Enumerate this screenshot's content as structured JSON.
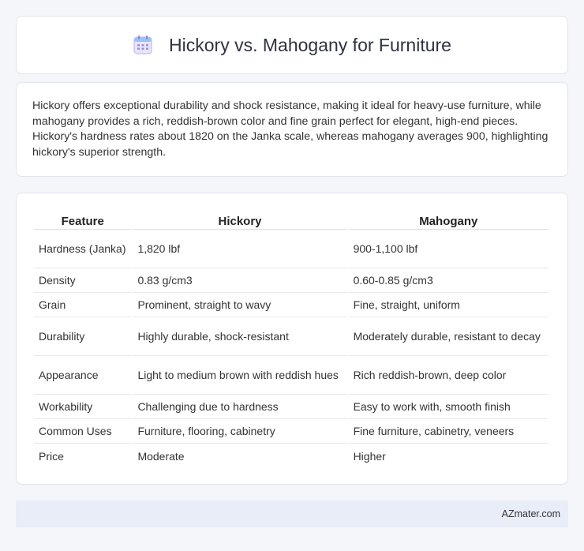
{
  "header": {
    "title": "Hickory vs. Mahogany for Furniture",
    "icon": "calendar-icon"
  },
  "summary": {
    "text": "Hickory offers exceptional durability and shock resistance, making it ideal for heavy-use furniture, while mahogany provides a rich, reddish-brown color and fine grain perfect for elegant, high-end pieces. Hickory's hardness rates about 1820 on the Janka scale, whereas mahogany averages 900, highlighting hickory's superior strength."
  },
  "table": {
    "headers": [
      "Feature",
      "Hickory",
      "Mahogany"
    ],
    "rows": [
      [
        "Hardness (Janka)",
        "1,820 lbf",
        "900-1,100 lbf"
      ],
      [
        "Density",
        "0.83 g/cm3",
        "0.60-0.85 g/cm3"
      ],
      [
        "Grain",
        "Prominent, straight to wavy",
        "Fine, straight, uniform"
      ],
      [
        "Durability",
        "Highly durable, shock-resistant",
        "Moderately durable, resistant to decay"
      ],
      [
        "Appearance",
        "Light to medium brown with reddish hues",
        "Rich reddish-brown, deep color"
      ],
      [
        "Workability",
        "Challenging due to hardness",
        "Easy to work with, smooth finish"
      ],
      [
        "Common Uses",
        "Furniture, flooring, cabinetry",
        "Fine furniture, cabinetry, veneers"
      ],
      [
        "Price",
        "Moderate",
        "Higher"
      ]
    ]
  },
  "footer": {
    "brand": "AZmater.com"
  },
  "colors": {
    "background": "#f5f6fa",
    "card": "#ffffff",
    "footer_bg": "#e8edf7",
    "icon_accent": "#8a7fe0"
  }
}
